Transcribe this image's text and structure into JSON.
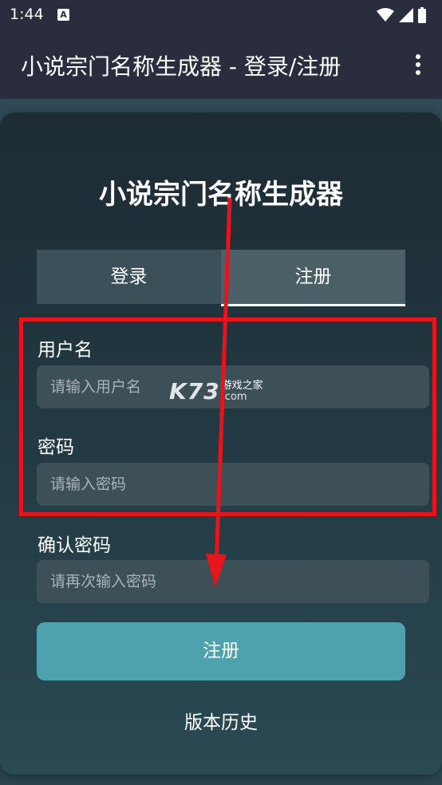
{
  "status_bar": {
    "time": "1:44",
    "notification_icon_letter": "A",
    "icons": [
      "wifi-icon",
      "signal-icon",
      "battery-icon"
    ]
  },
  "app_bar": {
    "title": "小说宗门名称生成器 - 登录/注册",
    "menu_icon": "more-vert-icon"
  },
  "card": {
    "title": "小说宗门名称生成器",
    "tabs": [
      {
        "label": "登录",
        "active": false
      },
      {
        "label": "注册",
        "active": true
      }
    ],
    "fields": {
      "username": {
        "label": "用户名",
        "placeholder": "请输入用户名",
        "value": ""
      },
      "password": {
        "label": "密码",
        "placeholder": "请输入密码",
        "value": ""
      },
      "confirm_password": {
        "label": "确认密码",
        "placeholder": "请再次输入密码",
        "value": ""
      }
    },
    "submit_label": "注册",
    "history_label": "版本历史"
  },
  "watermark": {
    "logo": "K73",
    "text": "游戏之家",
    "domain": ".com"
  },
  "colors": {
    "app_bar": "#2a2d3e",
    "button": "#4ea2ad",
    "annotation": "#e8141b"
  }
}
